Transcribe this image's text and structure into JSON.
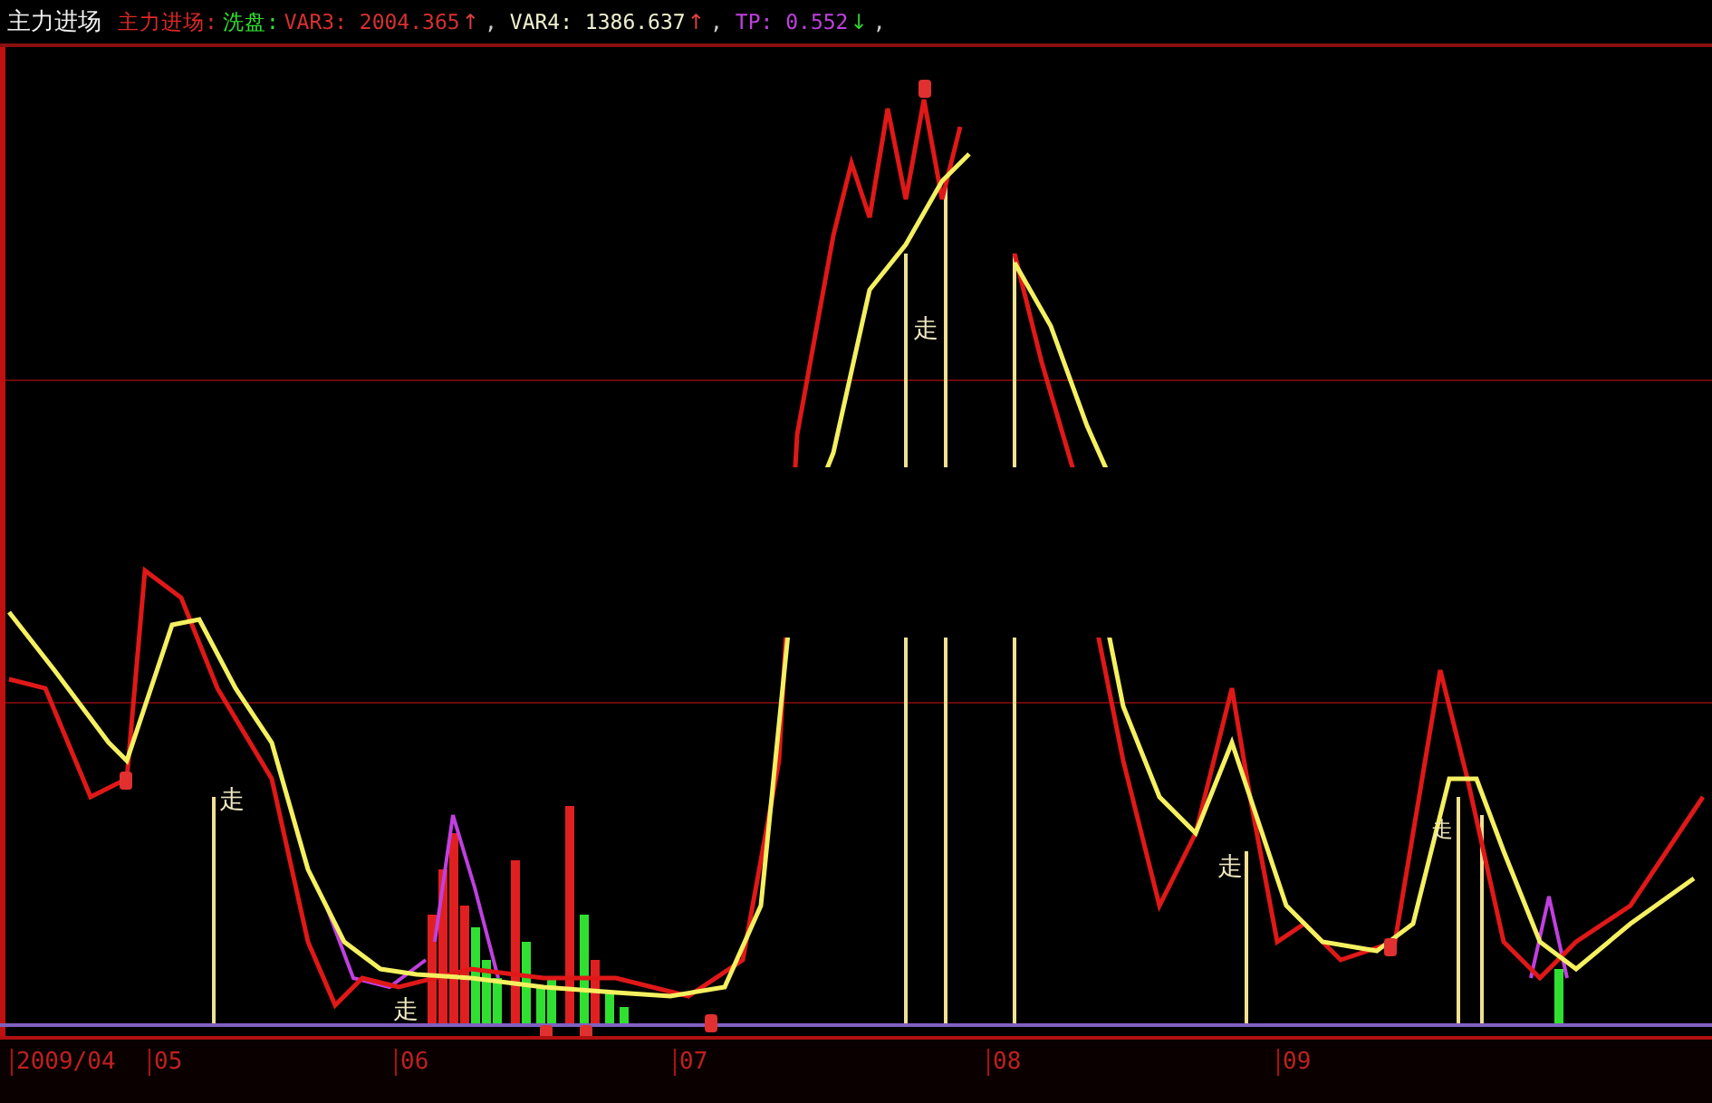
{
  "header": {
    "title": "主力进场",
    "items": [
      {
        "text": "主力进场:",
        "color": "#e02828"
      },
      {
        "text": "洗盘:",
        "color": "#30e030"
      },
      {
        "text": "VAR3: 2004.365",
        "color": "#d83030",
        "arrow": "↑",
        "rising": true,
        "separator": ","
      },
      {
        "text": "VAR4: 1386.637",
        "color": "#f0f0d0",
        "arrow": "↑",
        "rising": true,
        "separator": ","
      },
      {
        "text": "TP: 0.552",
        "color": "#c040e0",
        "arrow": "↓",
        "rising": false,
        "separator": ","
      }
    ]
  },
  "chart": {
    "signal_labels": [
      "走",
      "走",
      "走",
      "走",
      "走"
    ]
  },
  "x_axis": {
    "labels": [
      "2009/04",
      "05",
      "06",
      "07",
      "08",
      "09"
    ]
  }
}
